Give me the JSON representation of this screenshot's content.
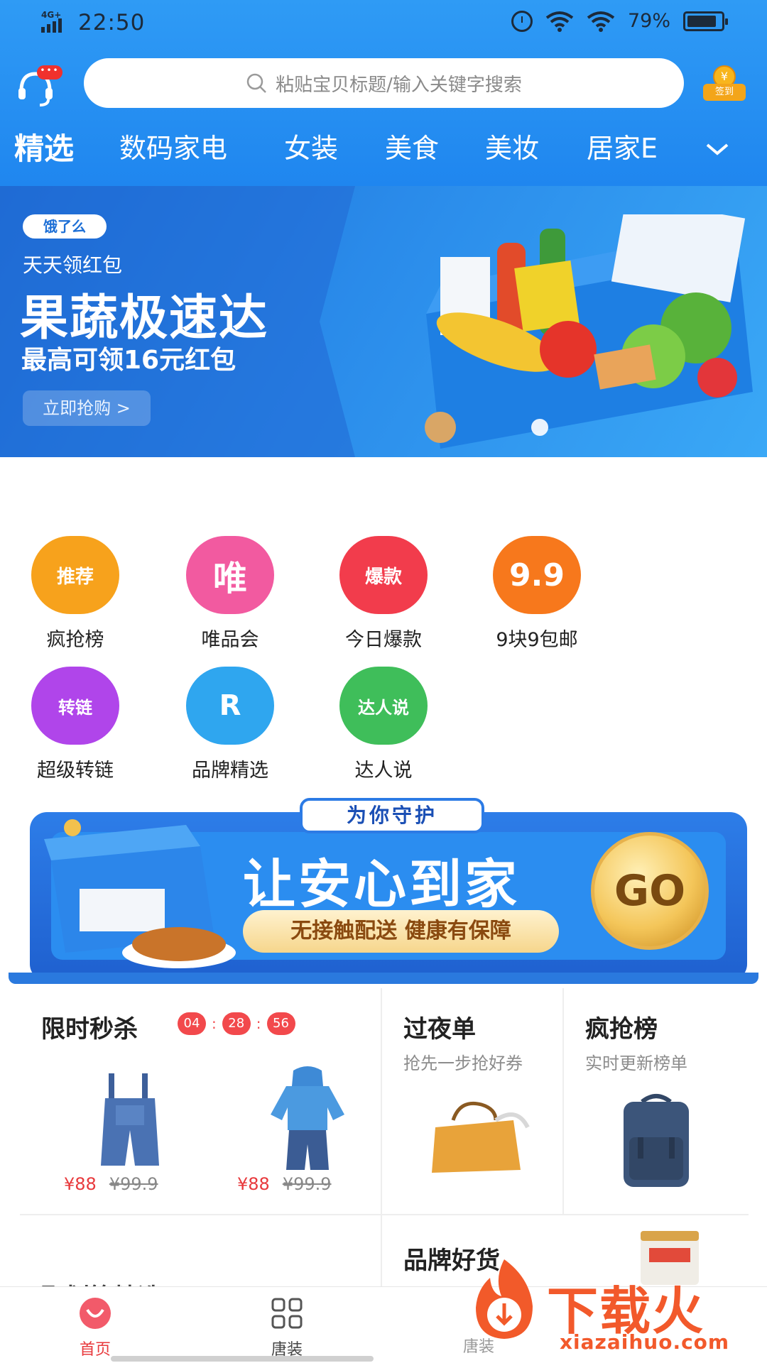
{
  "status_bar": {
    "network": "4G+",
    "time": "22:50",
    "battery": "79%"
  },
  "search": {
    "placeholder": "粘贴宝贝标题/输入关键字搜索"
  },
  "signin": {
    "coin_glyph": "¥",
    "label": "签到"
  },
  "service": {
    "badge": "•••"
  },
  "tabs": [
    "精选",
    "数码家电",
    "女装",
    "美食",
    "美妆",
    "居家E"
  ],
  "hero": {
    "logo": "饿了么",
    "subtitle": "天天领红包",
    "title": "果蔬极速达",
    "line2": "最高可领16元红包",
    "cta": "立即抢购 >"
  },
  "quick_icons": [
    {
      "label": "疯抢榜",
      "icon": "推荐",
      "color": "#f7a21c"
    },
    {
      "label": "唯品会",
      "icon": "唯",
      "color": "#f25aa0"
    },
    {
      "label": "今日爆款",
      "icon": "爆款",
      "color": "#f23c4c"
    },
    {
      "label": "9块9包邮",
      "icon": "9.9",
      "color": "#f7781c"
    },
    {
      "label": "超级转链",
      "icon": "转链",
      "color": "#b045ea"
    },
    {
      "label": "品牌精选",
      "icon": "R",
      "color": "#2fa6ef"
    },
    {
      "label": "达人说",
      "icon": "达人说",
      "color": "#3fbe5a"
    }
  ],
  "promo": {
    "top_badge": "为你守护",
    "headline": "让安心到家",
    "pill": "无接触配送 健康有保障",
    "go": "GO"
  },
  "cards": {
    "flash": {
      "title": "限时秒杀",
      "countdown": [
        "04",
        "28",
        "56"
      ],
      "items": [
        {
          "price": "¥88",
          "old_price": "¥99.9"
        },
        {
          "price": "¥88",
          "old_price": "¥99.9"
        }
      ]
    },
    "overnight": {
      "title": "过夜单",
      "subtitle": "抢先一步抢好券"
    },
    "hot": {
      "title": "疯抢榜",
      "subtitle": "实时更新榜单"
    },
    "brand": {
      "title": "品牌好货"
    },
    "partial": {
      "title": "聚划算精选"
    }
  },
  "bottom_nav": [
    {
      "label": "首页",
      "active": true
    },
    {
      "label": "唐装",
      "active": false
    },
    {
      "label": "唐装",
      "active": false
    }
  ],
  "watermark": {
    "text": "下载火",
    "url": "xiazaihuo.com"
  },
  "colors": {
    "primary": "#1f86ef",
    "accent_red": "#f2494c",
    "nav_active": "#e8393c"
  }
}
